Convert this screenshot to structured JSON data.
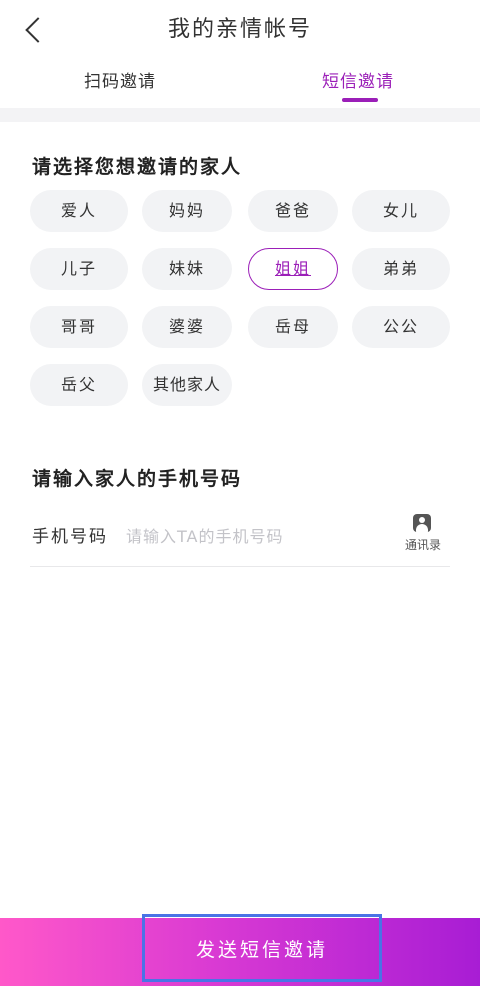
{
  "header": {
    "back_icon": "chevron-left-icon",
    "title": "我的亲情帐号"
  },
  "tabs": [
    {
      "label": "扫码邀请",
      "active": false
    },
    {
      "label": "短信邀请",
      "active": true
    }
  ],
  "family_section": {
    "title": "请选择您想邀请的家人",
    "options": [
      {
        "label": "爱人"
      },
      {
        "label": "妈妈"
      },
      {
        "label": "爸爸"
      },
      {
        "label": "女儿"
      },
      {
        "label": "儿子"
      },
      {
        "label": "妹妹"
      },
      {
        "label": "姐姐",
        "selected": true
      },
      {
        "label": "弟弟"
      },
      {
        "label": "哥哥"
      },
      {
        "label": "婆婆"
      },
      {
        "label": "岳母"
      },
      {
        "label": "公公"
      },
      {
        "label": "岳父"
      },
      {
        "label": "其他家人"
      }
    ]
  },
  "phone_section": {
    "title": "请输入家人的手机号码",
    "field_label": "手机号码",
    "placeholder": "请输入TA的手机号码",
    "value": "",
    "contacts_label": "通讯录",
    "contacts_icon": "contact-book-icon"
  },
  "footer": {
    "send_label": "发送短信邀请"
  },
  "colors": {
    "accent": "#9b1fb8",
    "gradient_start": "#ff58c9",
    "gradient_end": "#a81dd4",
    "chip_bg": "#f2f3f5"
  }
}
